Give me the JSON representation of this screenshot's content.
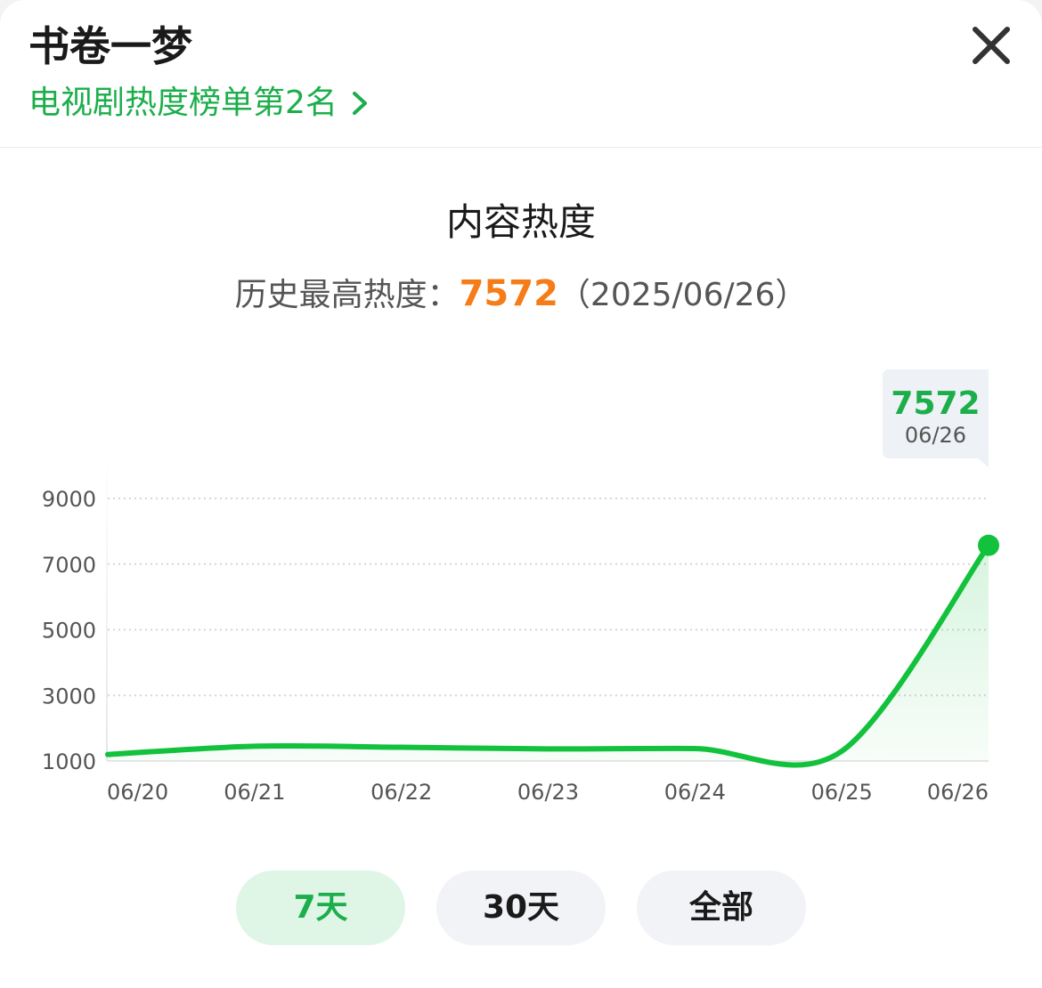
{
  "header": {
    "title": "书卷一梦",
    "rank_link": "电视剧热度榜单第2名"
  },
  "colors": {
    "accent_green": "#1cae4b",
    "peak_orange": "#f57c17",
    "line_green": "#12c13c"
  },
  "chart_title": "内容热度",
  "peak": {
    "label": "历史最高热度：",
    "value": "7572",
    "date": "（2025/06/26）"
  },
  "chart_data": {
    "type": "area",
    "title": "内容热度",
    "xlabel": "",
    "ylabel": "",
    "x": [
      "06/20",
      "06/21",
      "06/22",
      "06/23",
      "06/24",
      "06/25",
      "06/26"
    ],
    "y_ticks": [
      1000,
      3000,
      5000,
      7000,
      9000
    ],
    "ylim": [
      1000,
      9000
    ],
    "grid": true,
    "series": [
      {
        "values": [
          1200,
          1450,
          1420,
          1370,
          1380,
          1300,
          7572
        ]
      }
    ],
    "tooltip": {
      "value": "7572",
      "date": "06/26"
    }
  },
  "range_buttons": [
    {
      "label": "7天",
      "active": true
    },
    {
      "label": "30天",
      "active": false
    },
    {
      "label": "全部",
      "active": false
    }
  ],
  "icons": {
    "close": "close-icon",
    "chevron": "chevron-right-icon"
  }
}
